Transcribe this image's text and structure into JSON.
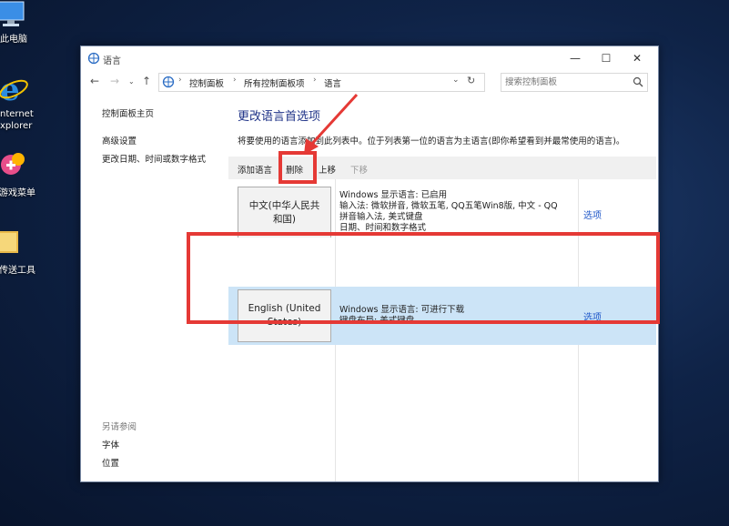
{
  "desktop": {
    "icons": [
      {
        "label": "此电脑",
        "icon": "computer-icon"
      },
      {
        "label_line1": "nternet",
        "label_line2": "xplorer",
        "icon": "internet-explorer-icon"
      },
      {
        "label": "游戏菜单",
        "icon": "game-menu-icon"
      },
      {
        "label": "传送工具",
        "icon": "folder-icon"
      }
    ]
  },
  "window": {
    "title": "语言",
    "controls": {
      "minimize": "—",
      "maximize": "☐",
      "close": "✕"
    },
    "address": {
      "crumbs": [
        "控制面板",
        "所有控制面板项",
        "语言"
      ],
      "search_placeholder": "搜索控制面板"
    },
    "sidebar": {
      "links": [
        "控制面板主页",
        "高级设置",
        "更改日期、时间或数字格式"
      ],
      "see_also_heading": "另请参阅",
      "see_also": [
        "字体",
        "位置"
      ]
    },
    "main": {
      "title": "更改语言首选项",
      "description": "将要使用的语言添加到此列表中。位于列表第一位的语言为主语言(即你希望看到并最常使用的语言)。",
      "toolbar": {
        "add": "添加语言",
        "remove": "删除",
        "up": "上移",
        "down": "下移"
      },
      "languages": [
        {
          "name_line1": "中文(中华人民共",
          "name_line2": "和国)",
          "info": [
            "Windows 显示语言: 已启用",
            "输入法: 微软拼音, 微软五笔, QQ五笔Win8版, 中文 - QQ",
            "拼音输入法, 美式键盘",
            "日期、时间和数字格式"
          ],
          "options": "选项"
        },
        {
          "name_line1": "English (United",
          "name_line2": "States)",
          "info": [
            "Windows 显示语言: 可进行下载",
            "键盘布局: 美式键盘"
          ],
          "options": "选项"
        }
      ]
    }
  },
  "colors": {
    "accent": "#1e3287",
    "link": "#1e56c8",
    "selected_row": "#cce4f7",
    "annotation": "#e53935"
  }
}
